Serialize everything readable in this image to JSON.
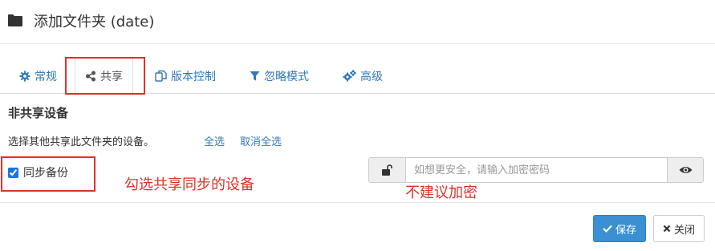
{
  "dialog": {
    "title": "添加文件夹 (date)"
  },
  "tabs": [
    {
      "label": "常规",
      "icon": "gear-icon"
    },
    {
      "label": "共享",
      "icon": "share-icon"
    },
    {
      "label": "版本控制",
      "icon": "copy-icon"
    },
    {
      "label": "忽略模式",
      "icon": "filter-icon"
    },
    {
      "label": "高级",
      "icon": "gears-icon"
    }
  ],
  "sharing": {
    "section_title": "非共享设备",
    "description": "选择其他共享此文件夹的设备。",
    "select_all": "全选",
    "deselect_all": "取消全选",
    "device": {
      "name": "同步备份",
      "checked": true
    },
    "password_placeholder": "如想更安全，请输入加密密码"
  },
  "annotations": {
    "share_note": "勾选共享同步的设备",
    "encrypt_note": "不建议加密"
  },
  "buttons": {
    "save": "保存",
    "close": "关闭"
  },
  "colors": {
    "link": "#337ab7",
    "primary": "#3b8fd3",
    "annotation": "#e0312b"
  }
}
